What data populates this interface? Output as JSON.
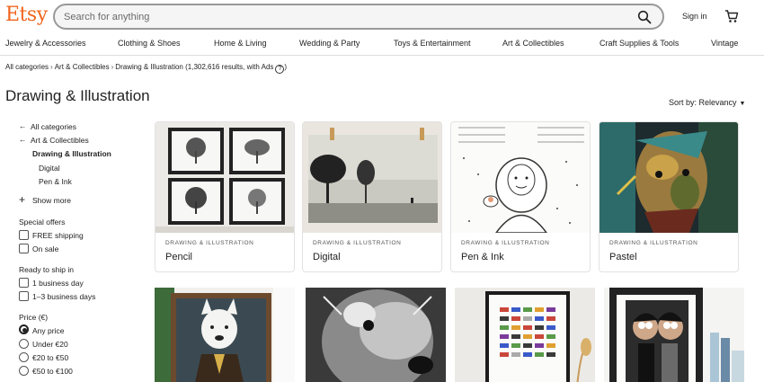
{
  "header": {
    "logo": "Etsy",
    "search_placeholder": "Search for anything",
    "signin": "Sign in"
  },
  "catnav": [
    "Jewelry & Accessories",
    "Clothing & Shoes",
    "Home & Living",
    "Wedding & Party",
    "Toys & Entertainment",
    "Art & Collectibles",
    "Craft Supplies & Tools",
    "Vintage"
  ],
  "breadcrumb": {
    "root": "All categories",
    "parent": "Art & Collectibles",
    "current": "Drawing & Illustration",
    "results": "(1,302,616 results, with Ads"
  },
  "page_title": "Drawing & Illustration",
  "sort": {
    "label": "Sort by: Relevancy"
  },
  "sidebar": {
    "back_all": "All categories",
    "back_parent": "Art & Collectibles",
    "current": "Drawing & Illustration",
    "subcats": [
      "Digital",
      "Pen & Ink"
    ],
    "show_more": "Show more",
    "special_offers": {
      "heading": "Special offers",
      "options": [
        "FREE shipping",
        "On sale"
      ]
    },
    "ready_to_ship": {
      "heading": "Ready to ship in",
      "options": [
        "1 business day",
        "1–3 business days"
      ]
    },
    "price": {
      "heading": "Price (€)",
      "options": [
        "Any price",
        "Under €20",
        "€20 to €50",
        "€50 to €100"
      ],
      "selected": "Any price"
    }
  },
  "cards": [
    {
      "kicker": "DRAWING & ILLUSTRATION",
      "name": "Pencil"
    },
    {
      "kicker": "DRAWING & ILLUSTRATION",
      "name": "Digital"
    },
    {
      "kicker": "DRAWING & ILLUSTRATION",
      "name": "Pen & Ink"
    },
    {
      "kicker": "DRAWING & ILLUSTRATION",
      "name": "Pastel"
    }
  ],
  "colors": {
    "brand": "#f1641e",
    "text": "#222222",
    "border": "#e2e2e2"
  }
}
